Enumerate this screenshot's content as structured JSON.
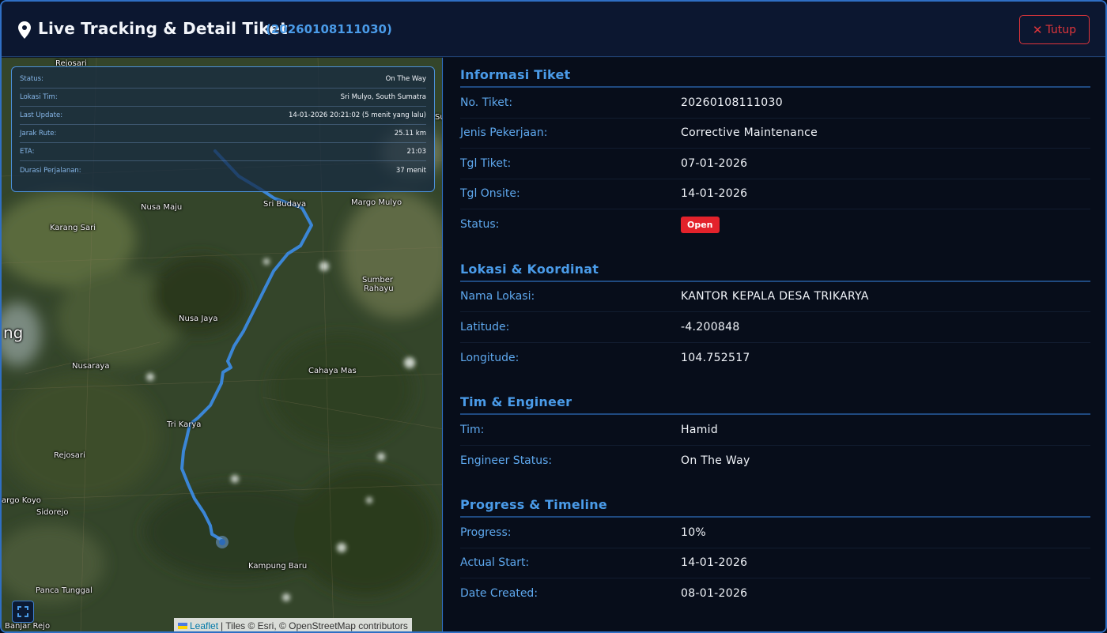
{
  "header": {
    "title": "Live Tracking & Detail Tiket",
    "ticket_id": "(20260108111030)",
    "close_label": "Tutup",
    "close_icon": "close-icon",
    "title_icon": "map-pin-icon"
  },
  "map": {
    "status_panel": {
      "status_label": "Status:",
      "status_value": "On The Way",
      "location_label": "Lokasi Tim:",
      "location_value": "Sri Mulyo, South Sumatra",
      "update_label": "Last Update:",
      "update_value": "14-01-2026 20:21:02 (5 menit yang lalu)",
      "distance_label": "Jarak Rute:",
      "distance_value": "25.11 km",
      "eta_label": "ETA:",
      "eta_value": "21:03",
      "duration_label": "Durasi Perjalanan:",
      "duration_value": "37 menit"
    },
    "places": {
      "rejosari_top": "Rejosari",
      "su": "Su",
      "nusa_maju": "Nusa Maju",
      "sri_budaya": "Sri Budaya",
      "margo_mulyo": "Margo Mulyo",
      "karang_sari": "Karang Sari",
      "sumber_rahayu_1": "Sumber",
      "sumber_rahayu_2": "Rahayu",
      "ng": "ng",
      "nusa_jaya": "Nusa Jaya",
      "nusaraya": "Nusaraya",
      "cahaya_mas": "Cahaya Mas",
      "tri_karya": "Tri Karya",
      "rejosari": "Rejosari",
      "margo_koyo": "argo Koyo",
      "sidorejo": "Sidorejo",
      "kampung_baru": "Kampung Baru",
      "panca_tunggal": "Panca Tunggal",
      "banjar_rejo": "Banjar Rejo"
    },
    "attribution": {
      "leaflet": "Leaflet",
      "rest": "| Tiles © Esri, © OpenStreetMap contributors"
    },
    "fullscreen_icon": "fullscreen-icon",
    "route_color": "#3b86d6"
  },
  "details": {
    "info": {
      "title": "Informasi Tiket",
      "ticket_no_label": "No. Tiket:",
      "ticket_no": "20260108111030",
      "job_type_label": "Jenis Pekerjaan:",
      "job_type": "Corrective Maintenance",
      "ticket_date_label": "Tgl Tiket:",
      "ticket_date": "07-01-2026",
      "onsite_date_label": "Tgl Onsite:",
      "onsite_date": "14-01-2026",
      "status_label": "Status:",
      "status": "Open"
    },
    "location": {
      "title": "Lokasi & Koordinat",
      "name_label": "Nama Lokasi:",
      "name": "KANTOR KEPALA DESA TRIKARYA",
      "lat_label": "Latitude:",
      "lat": "-4.200848",
      "lng_label": "Longitude:",
      "lng": "104.752517"
    },
    "team": {
      "title": "Tim & Engineer",
      "team_label": "Tim:",
      "team": "Hamid",
      "engineer_status_label": "Engineer Status:",
      "engineer_status": "On The Way"
    },
    "progress": {
      "title": "Progress & Timeline",
      "progress_label": "Progress:",
      "progress": "10%",
      "actual_start_label": "Actual Start:",
      "actual_start": "14-01-2026",
      "date_created_label": "Date Created:",
      "date_created": "08-01-2026"
    }
  },
  "colors": {
    "accent": "#4a9be8",
    "danger": "#e3222b",
    "border": "#2f6fc4"
  }
}
